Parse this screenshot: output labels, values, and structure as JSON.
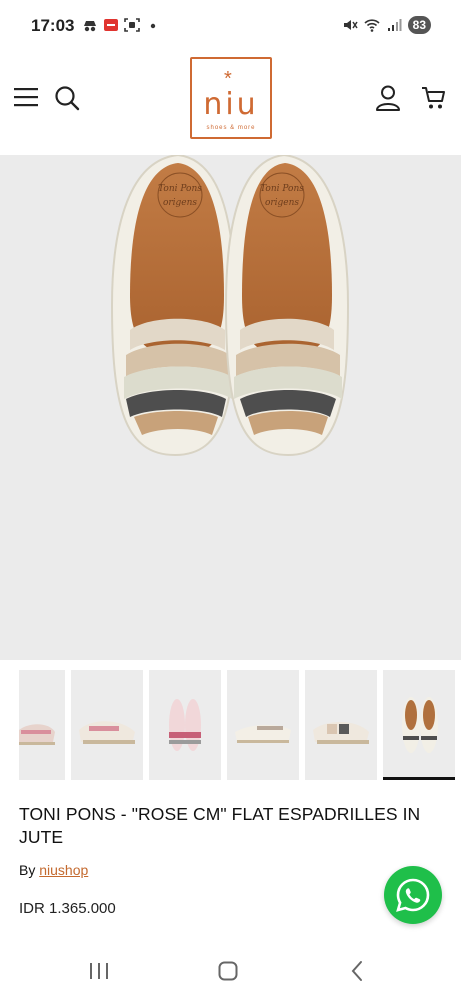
{
  "status_bar": {
    "time": "17:03",
    "battery": "83",
    "icons": [
      "incognito-icon",
      "notification-icon",
      "screenshot-icon",
      "dot-icon",
      "mute-icon",
      "wifi-icon",
      "signal-icon",
      "battery-icon"
    ]
  },
  "header": {
    "logo_text": "niu",
    "logo_sub": "shoes & more",
    "icons": [
      "menu-icon",
      "search-icon",
      "account-icon",
      "cart-icon"
    ]
  },
  "colors": {
    "brand": "#cf6a33",
    "link": "#c46a2f",
    "whatsapp": "#1fbf4a",
    "image_bg": "#ebebeb"
  },
  "product": {
    "title": "TONI PONS - \"ROSE CM\" FLAT ESPADRILLES IN JUTE",
    "by_prefix": "By ",
    "vendor": "niushop",
    "price": "IDR 1.365.000",
    "insole_brand": "Toni Pons",
    "insole_sub": "origens"
  },
  "thumbnails": {
    "count": 6,
    "active_index": 5
  },
  "nav_bar": {
    "icons": [
      "recents-icon",
      "home-icon",
      "back-icon"
    ]
  }
}
